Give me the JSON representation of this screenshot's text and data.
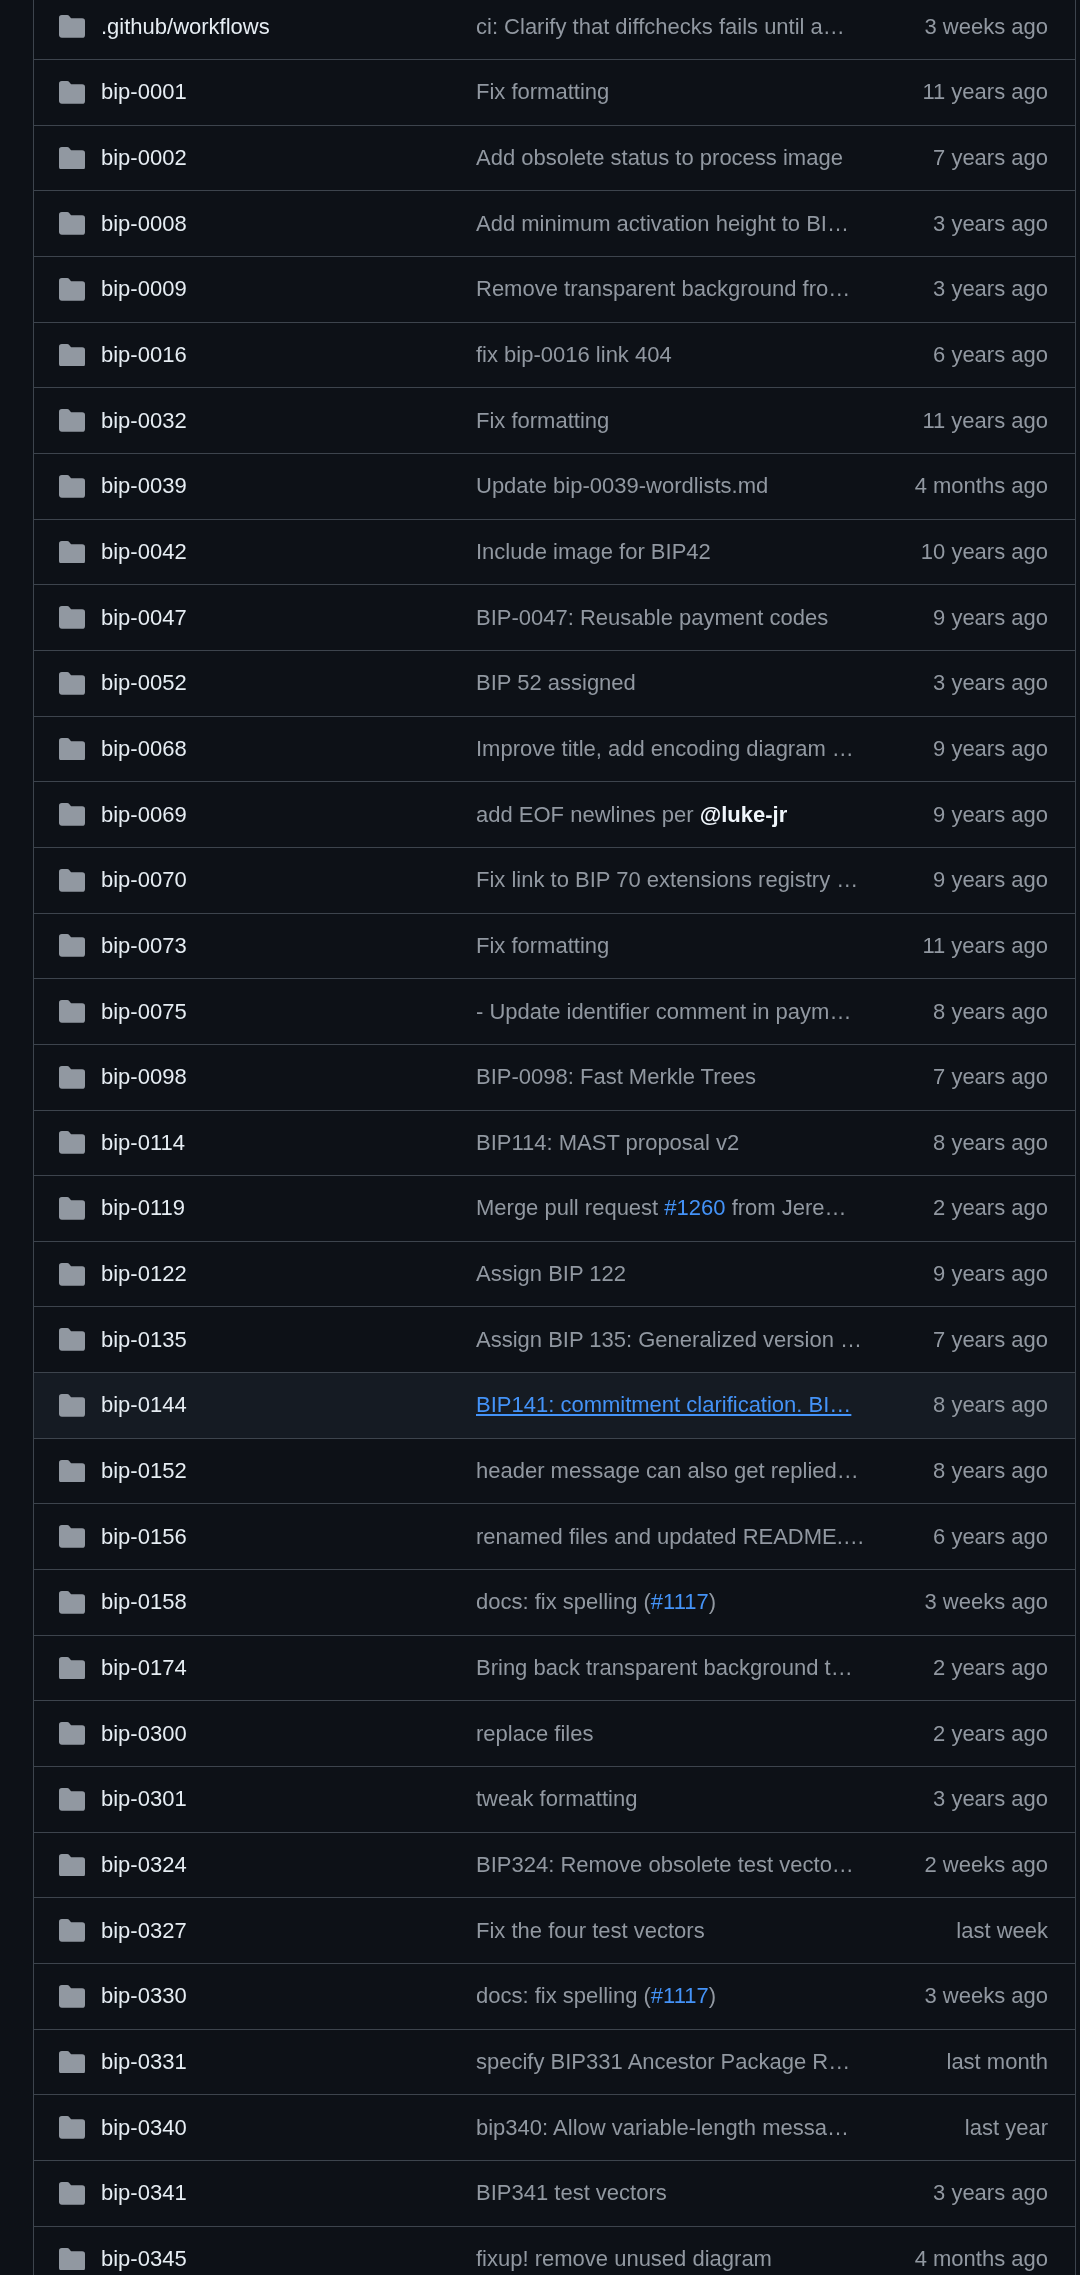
{
  "file_table": {
    "rows": [
      {
        "name": ".github/workflows",
        "message": "ci: Clarify that diffchecks fails until a…",
        "date": "3 weeks ago",
        "hovered": false
      },
      {
        "name": "bip-0001",
        "message": "Fix formatting",
        "date": "11 years ago",
        "hovered": false
      },
      {
        "name": "bip-0002",
        "message": "Add obsolete status to process image",
        "date": "7 years ago",
        "hovered": false
      },
      {
        "name": "bip-0008",
        "message": "Add minimum activation height to BI…",
        "date": "3 years ago",
        "hovered": false
      },
      {
        "name": "bip-0009",
        "message": "Remove transparent background fro…",
        "date": "3 years ago",
        "hovered": false
      },
      {
        "name": "bip-0016",
        "message": "fix bip-0016 link 404",
        "date": "6 years ago",
        "hovered": false
      },
      {
        "name": "bip-0032",
        "message": "Fix formatting",
        "date": "11 years ago",
        "hovered": false
      },
      {
        "name": "bip-0039",
        "message": "Update bip-0039-wordlists.md",
        "date": "4 months ago",
        "hovered": false
      },
      {
        "name": "bip-0042",
        "message": "Include image for BIP42",
        "date": "10 years ago",
        "hovered": false
      },
      {
        "name": "bip-0047",
        "message": "BIP-0047: Reusable payment codes",
        "date": "9 years ago",
        "hovered": false
      },
      {
        "name": "bip-0052",
        "message": "BIP 52 assigned",
        "date": "3 years ago",
        "hovered": false
      },
      {
        "name": "bip-0068",
        "message": "Improve title, add encoding diagram …",
        "date": "9 years ago",
        "hovered": false
      },
      {
        "name": "bip-0069",
        "message": [
          {
            "text": "add EOF newlines per ",
            "kind": "plain"
          },
          {
            "text": "@luke-jr",
            "kind": "mention"
          }
        ],
        "date": "9 years ago",
        "hovered": false
      },
      {
        "name": "bip-0070",
        "message": "Fix link to BIP 70 extensions registry …",
        "date": "9 years ago",
        "hovered": false
      },
      {
        "name": "bip-0073",
        "message": "Fix formatting",
        "date": "11 years ago",
        "hovered": false
      },
      {
        "name": "bip-0075",
        "message": "- Update identifier comment in paym…",
        "date": "8 years ago",
        "hovered": false
      },
      {
        "name": "bip-0098",
        "message": "BIP-0098: Fast Merkle Trees",
        "date": "7 years ago",
        "hovered": false
      },
      {
        "name": "bip-0114",
        "message": "BIP114: MAST proposal v2",
        "date": "8 years ago",
        "hovered": false
      },
      {
        "name": "bip-0119",
        "message": [
          {
            "text": "Merge pull request ",
            "kind": "plain"
          },
          {
            "text": "#1260",
            "kind": "issue_link"
          },
          {
            "text": " from Jere…",
            "kind": "plain"
          }
        ],
        "date": "2 years ago",
        "hovered": false
      },
      {
        "name": "bip-0122",
        "message": "Assign BIP 122",
        "date": "9 years ago",
        "hovered": false
      },
      {
        "name": "bip-0135",
        "message": "Assign BIP 135: Generalized version …",
        "date": "7 years ago",
        "hovered": false
      },
      {
        "name": "bip-0144",
        "message": "BIP141: commitment clarification. BI…",
        "date": "8 years ago",
        "hovered": true
      },
      {
        "name": "bip-0152",
        "message": "header message can also get replied…",
        "date": "8 years ago",
        "hovered": false
      },
      {
        "name": "bip-0156",
        "message": "renamed files and updated README.…",
        "date": "6 years ago",
        "hovered": false
      },
      {
        "name": "bip-0158",
        "message": [
          {
            "text": "docs: fix spelling (",
            "kind": "plain"
          },
          {
            "text": "#1117",
            "kind": "issue_link"
          },
          {
            "text": ")",
            "kind": "plain"
          }
        ],
        "date": "3 weeks ago",
        "hovered": false
      },
      {
        "name": "bip-0174",
        "message": "Bring back transparent background t…",
        "date": "2 years ago",
        "hovered": false
      },
      {
        "name": "bip-0300",
        "message": "replace files",
        "date": "2 years ago",
        "hovered": false
      },
      {
        "name": "bip-0301",
        "message": "tweak formatting",
        "date": "3 years ago",
        "hovered": false
      },
      {
        "name": "bip-0324",
        "message": "BIP324: Remove obsolete test vecto…",
        "date": "2 weeks ago",
        "hovered": false
      },
      {
        "name": "bip-0327",
        "message": "Fix the four test vectors",
        "date": "last week",
        "hovered": false
      },
      {
        "name": "bip-0330",
        "message": [
          {
            "text": "docs: fix spelling (",
            "kind": "plain"
          },
          {
            "text": "#1117",
            "kind": "issue_link"
          },
          {
            "text": ")",
            "kind": "plain"
          }
        ],
        "date": "3 weeks ago",
        "hovered": false
      },
      {
        "name": "bip-0331",
        "message": "specify BIP331 Ancestor Package R…",
        "date": "last month",
        "hovered": false
      },
      {
        "name": "bip-0340",
        "message": "bip340: Allow variable-length messa…",
        "date": "last year",
        "hovered": false
      },
      {
        "name": "bip-0341",
        "message": "BIP341 test vectors",
        "date": "3 years ago",
        "hovered": false
      },
      {
        "name": "bip-0345",
        "message": "fixup! remove unused diagram",
        "date": "4 months ago",
        "hovered": false
      }
    ]
  }
}
